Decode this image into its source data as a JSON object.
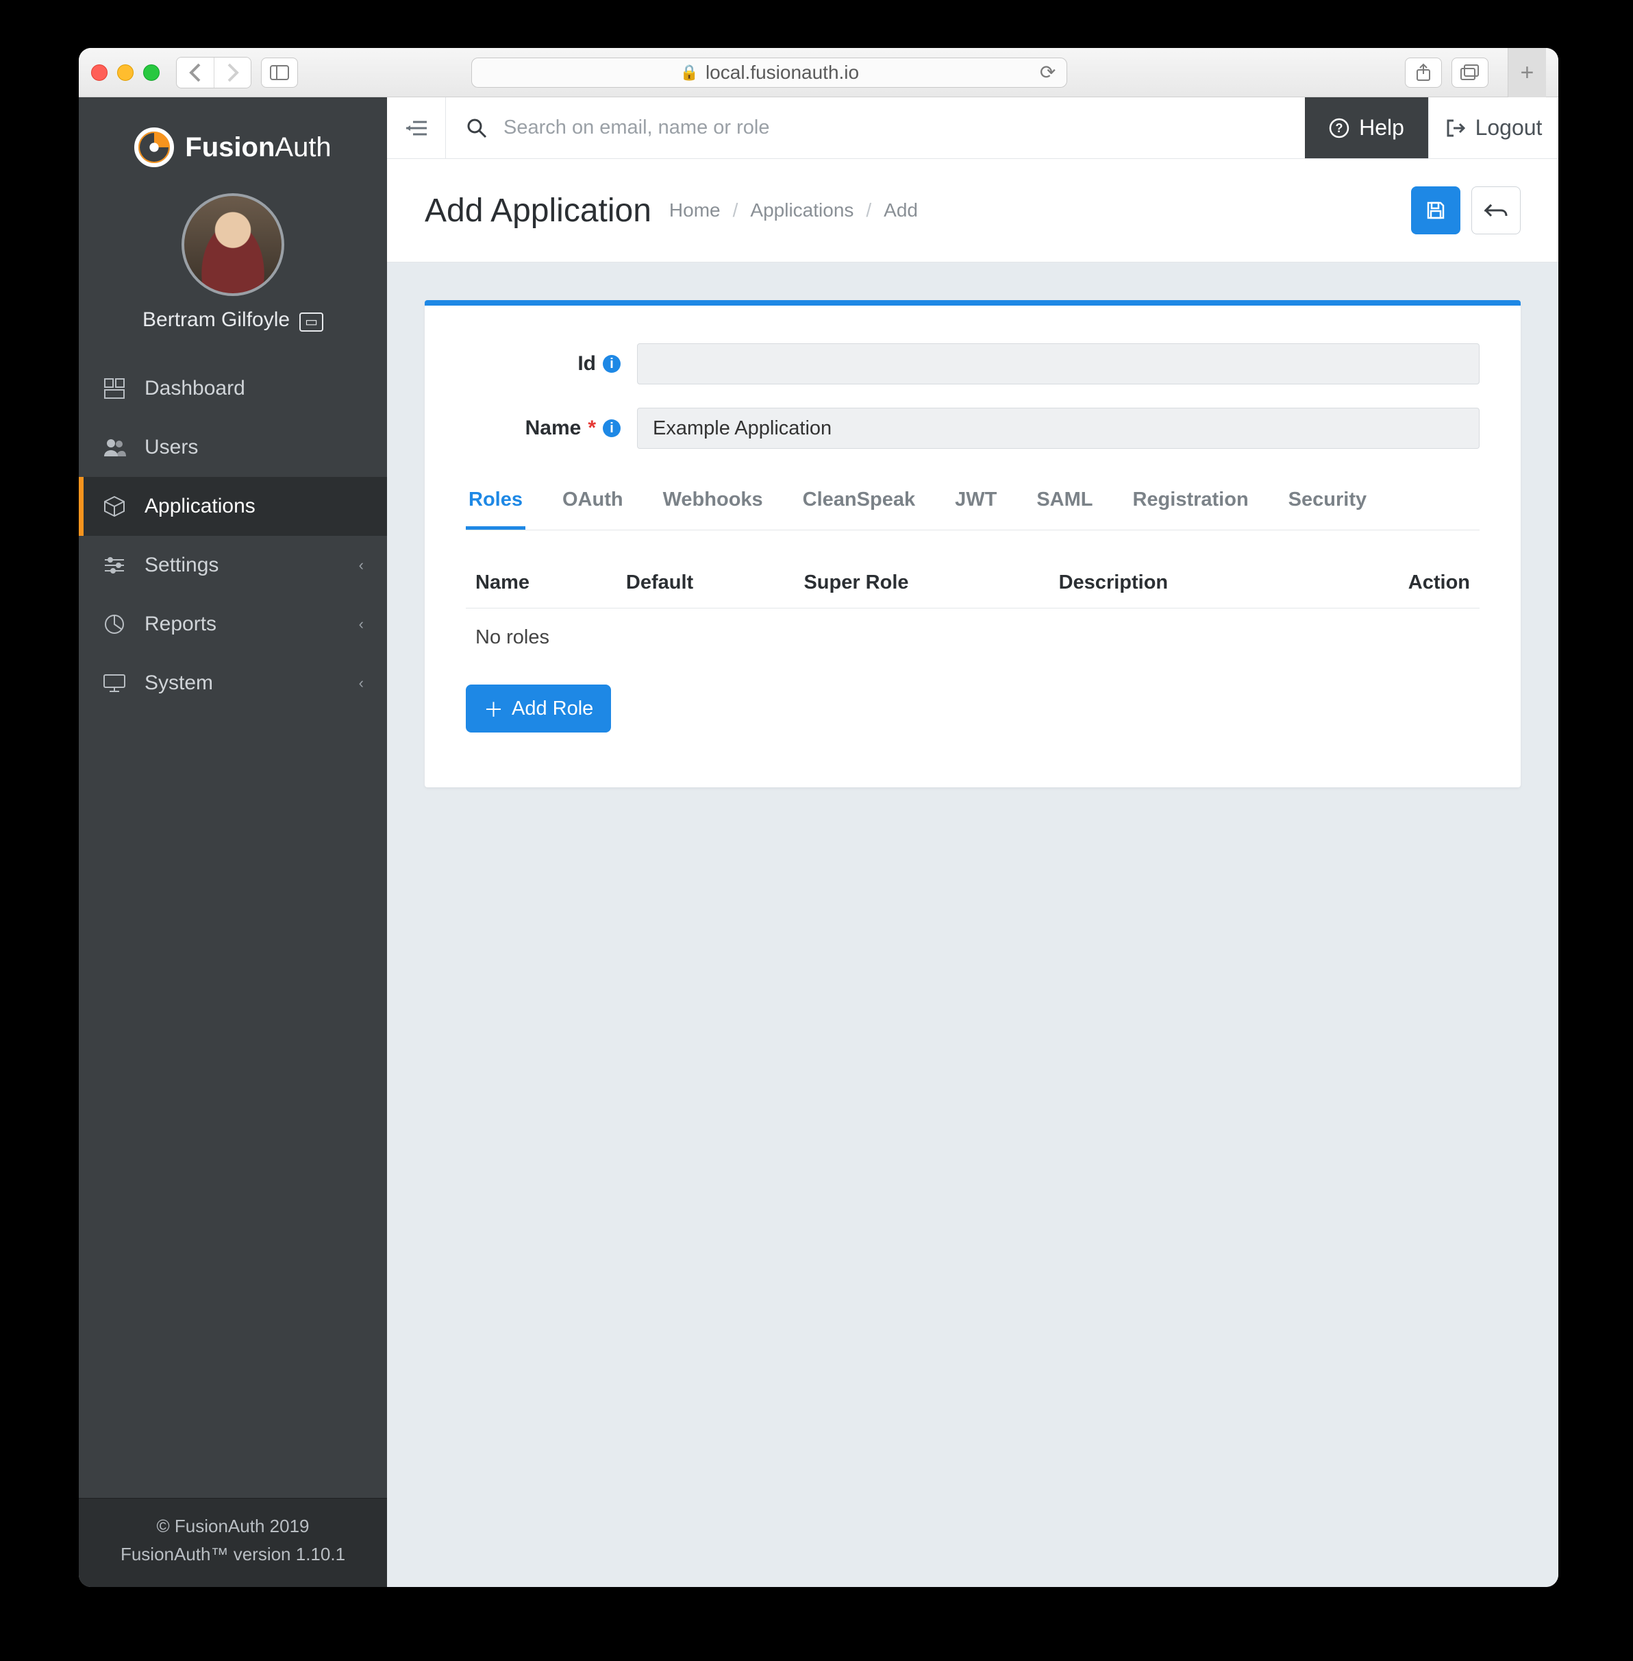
{
  "browser": {
    "address": "local.fusionauth.io"
  },
  "brand": {
    "part1": "Fusion",
    "part2": "Auth"
  },
  "user": {
    "name": "Bertram Gilfoyle"
  },
  "sidebar": {
    "items": [
      {
        "label": "Dashboard",
        "icon": "dashboard"
      },
      {
        "label": "Users",
        "icon": "users"
      },
      {
        "label": "Applications",
        "icon": "cube",
        "active": true
      },
      {
        "label": "Settings",
        "icon": "sliders",
        "chevron": true
      },
      {
        "label": "Reports",
        "icon": "pie",
        "chevron": true
      },
      {
        "label": "System",
        "icon": "monitor",
        "chevron": true
      }
    ]
  },
  "footer": {
    "line1": "© FusionAuth 2019",
    "line2": "FusionAuth™ version 1.10.1"
  },
  "topbar": {
    "search_placeholder": "Search on email, name or role",
    "help": "Help",
    "logout": "Logout"
  },
  "page": {
    "title": "Add Application",
    "breadcrumbs": [
      "Home",
      "Applications",
      "Add"
    ]
  },
  "form": {
    "id_label": "Id",
    "id_value": "",
    "name_label": "Name",
    "name_required": "*",
    "name_value": "Example Application"
  },
  "tabs": [
    "Roles",
    "OAuth",
    "Webhooks",
    "CleanSpeak",
    "JWT",
    "SAML",
    "Registration",
    "Security"
  ],
  "active_tab_index": 0,
  "roles_table": {
    "columns": [
      "Name",
      "Default",
      "Super Role",
      "Description",
      "Action"
    ],
    "empty": "No roles"
  },
  "add_role_label": "Add Role"
}
